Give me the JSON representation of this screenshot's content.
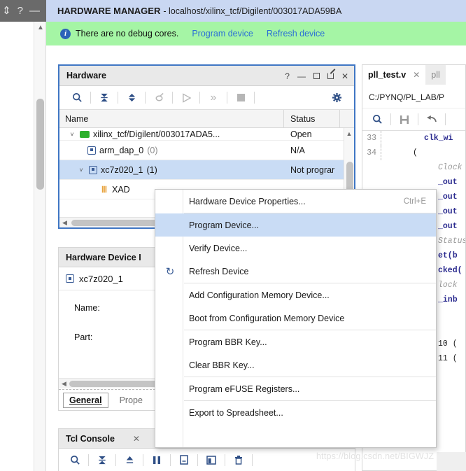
{
  "window": {
    "top_icons": [
      "resize-icon",
      "help-icon",
      "minimize-icon"
    ],
    "resize_glyph": "⇕",
    "help_glyph": "?",
    "minimize_glyph": "—",
    "title_strong": "HARDWARE MANAGER",
    "title_rest": "- localhost/xilinx_tcf/Digilent/003017ADA59BA"
  },
  "info_banner": {
    "icon": "info-icon",
    "icon_glyph": "i",
    "message": "There are no debug cores.",
    "links": [
      "Program device",
      "Refresh device"
    ],
    "bg_color": "#a5f5a5",
    "link_color": "#2a6fd6"
  },
  "hardware_panel": {
    "title": "Hardware",
    "header_buttons": [
      "?",
      "—",
      "□",
      "↗",
      "✕"
    ],
    "toolbar_icons": [
      "search-icon",
      "collapse-all-icon",
      "expand-all-icon",
      "unlink-icon",
      "run-icon",
      "step-icon",
      "stop-icon",
      "settings-gear-icon"
    ],
    "columns": [
      "Name",
      "Status"
    ],
    "rows": [
      {
        "indent": 1,
        "chevron": "˅",
        "icon": "server-green-icon",
        "label": "xilinx_tcf/Digilent/003017ADA5...",
        "suffix": "",
        "status": "Open",
        "selected": false
      },
      {
        "indent": 2,
        "chevron": "",
        "icon": "chip-icon",
        "label": "arm_dap_0",
        "suffix": "(0)",
        "status": "N/A",
        "selected": false
      },
      {
        "indent": 2,
        "chevron": "˅",
        "icon": "chip-icon",
        "label": "xc7z020_1",
        "suffix": "(1)",
        "status": "Not prograr",
        "selected": true
      },
      {
        "indent": 3,
        "chevron": "",
        "icon": "xadc-icon",
        "label": "XAD",
        "suffix": "",
        "status": "",
        "selected": false
      }
    ]
  },
  "device_properties_panel": {
    "title": "Hardware Device I",
    "device_icon": "chip-icon",
    "device_name": "xc7z020_1",
    "fields": [
      "Name:",
      "Part:"
    ],
    "tabs": [
      {
        "label": "General",
        "active": true
      },
      {
        "label": "Prope",
        "active": false
      }
    ]
  },
  "tcl_console_panel": {
    "title": "Tcl Console",
    "close_glyph": "✕",
    "toolbar_icons": [
      "search-icon",
      "collapse-icon",
      "expand-icon",
      "pause-icon",
      "copy-icon",
      "window-icon",
      "trash-icon"
    ]
  },
  "editor_panel": {
    "tabs": [
      {
        "label": "pll_test.v",
        "active": true,
        "close_glyph": "✕"
      },
      {
        "label": "pll",
        "active": false
      }
    ],
    "path": "C:/PYNQ/PL_LAB/P",
    "toolbar_icons": [
      "search-icon",
      "save-icon",
      "undo-icon"
    ],
    "code_lines": [
      {
        "num": "33",
        "text": "clk_wi",
        "style": "code"
      },
      {
        "num": "34",
        "text": "(",
        "style": "plain"
      },
      {
        "num": "",
        "text": "Clock",
        "style": "comment"
      },
      {
        "num": "",
        "text": "_out",
        "style": "code"
      },
      {
        "num": "",
        "text": "_out",
        "style": "code"
      },
      {
        "num": "",
        "text": "_out",
        "style": "code"
      },
      {
        "num": "",
        "text": "_out",
        "style": "code"
      },
      {
        "num": "",
        "text": "Status",
        "style": "comment"
      },
      {
        "num": "",
        "text": "et(b",
        "style": "code"
      },
      {
        "num": "",
        "text": "cked(",
        "style": "code"
      },
      {
        "num": "",
        "text": "lock",
        "style": "comment"
      },
      {
        "num": "",
        "text": "_inb",
        "style": "code"
      },
      {
        "num": "",
        "text": "",
        "style": "plain"
      },
      {
        "num": "",
        "text": "10 (",
        "style": "num"
      },
      {
        "num": "",
        "text": "11 (",
        "style": "num"
      }
    ]
  },
  "context_menu": {
    "items": [
      {
        "label": "Hardware Device Properties...",
        "accel": "Ctrl+E",
        "icon": "",
        "highlighted": false,
        "separator_after": true
      },
      {
        "label": "Program Device...",
        "accel": "",
        "icon": "",
        "highlighted": true,
        "separator_after": false
      },
      {
        "label": "Verify Device...",
        "accel": "",
        "icon": "",
        "highlighted": false,
        "separator_after": false
      },
      {
        "label": "Refresh Device",
        "accel": "",
        "icon": "refresh-icon",
        "highlighted": false,
        "separator_after": true
      },
      {
        "label": "Add Configuration Memory Device...",
        "accel": "",
        "icon": "",
        "highlighted": false,
        "separator_after": false
      },
      {
        "label": "Boot from Configuration Memory Device",
        "accel": "",
        "icon": "",
        "highlighted": false,
        "separator_after": true
      },
      {
        "label": "Program BBR Key...",
        "accel": "",
        "icon": "",
        "highlighted": false,
        "separator_after": false
      },
      {
        "label": "Clear BBR Key...",
        "accel": "",
        "icon": "",
        "highlighted": false,
        "separator_after": true
      },
      {
        "label": "Program eFUSE Registers...",
        "accel": "",
        "icon": "",
        "highlighted": false,
        "separator_after": true
      },
      {
        "label": "Export to Spreadsheet...",
        "accel": "",
        "icon": "",
        "highlighted": false,
        "separator_after": false
      }
    ],
    "refresh_glyph": "↻",
    "highlight_color": "#c9dcf5"
  },
  "watermark": {
    "text": "https://blog.csdn.net/BIGWJZ"
  }
}
